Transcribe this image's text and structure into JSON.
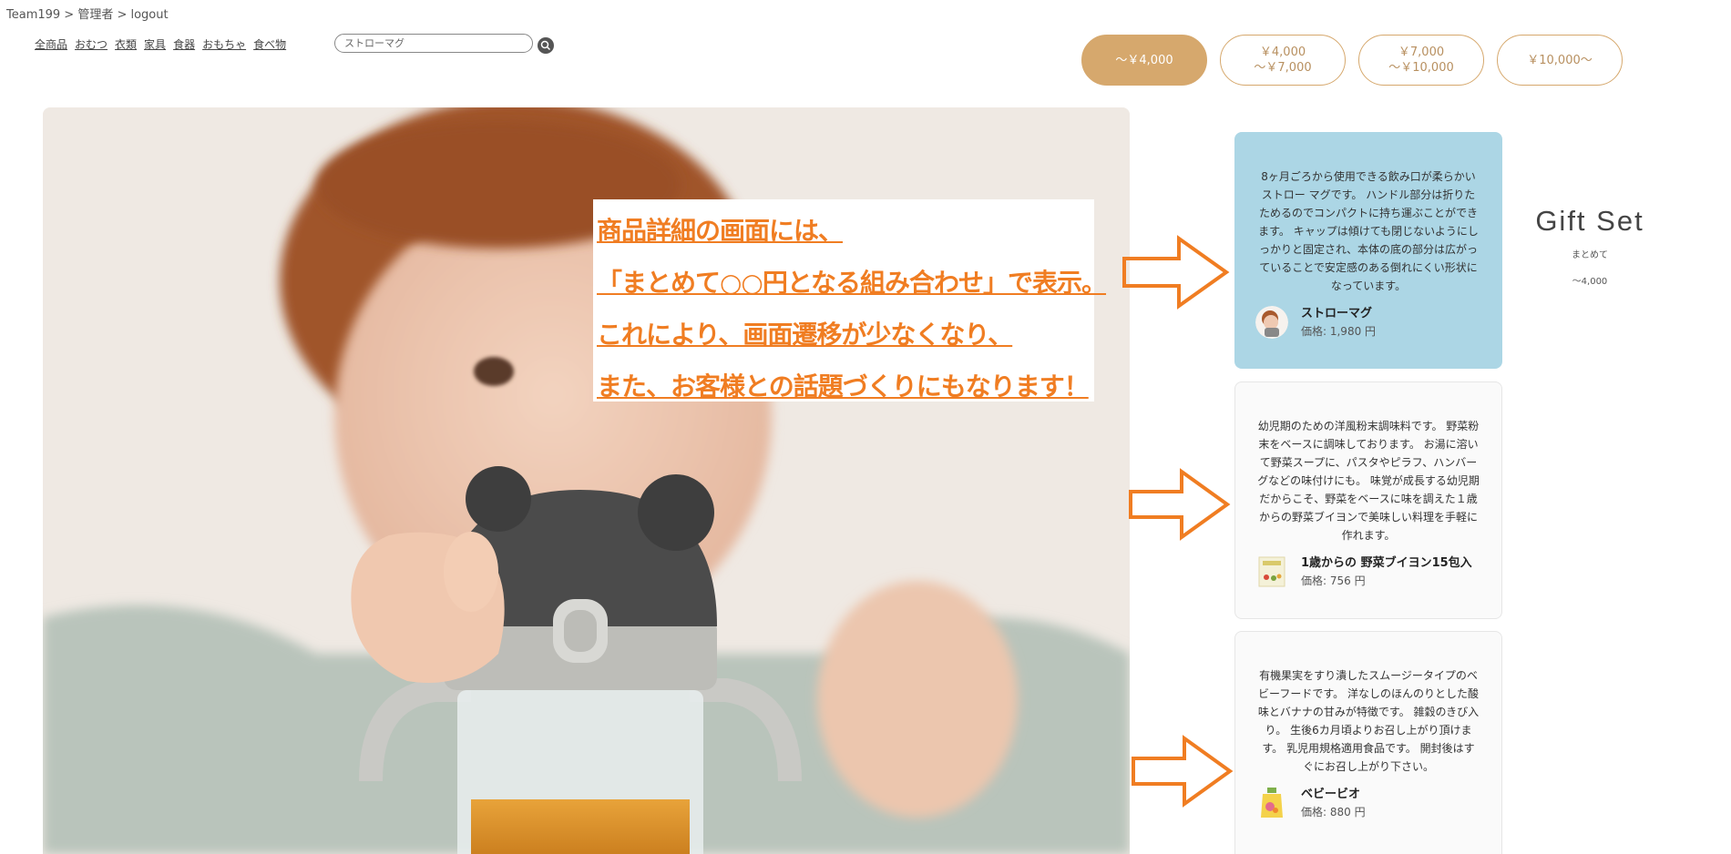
{
  "breadcrumb": "Team199 > 管理者 > logout",
  "nav": [
    "全商品",
    "おむつ",
    "衣類",
    "家具",
    "食器",
    "おもちゃ",
    "食べ物"
  ],
  "search": {
    "placeholder": "ストローマグ"
  },
  "price_filters": [
    {
      "label": "～￥4,000",
      "active": true
    },
    {
      "label": "￥4,000\n～￥7,000",
      "active": false
    },
    {
      "label": "￥7,000\n～￥10,000",
      "active": false
    },
    {
      "label": "￥10,000～",
      "active": false
    }
  ],
  "callout": [
    "商品詳細の画面には、",
    "「まとめて○○円となる組み合わせ」で表示。",
    "これにより、画面遷移が少なくなり、",
    "また、お客様との話題づくりにもなります！"
  ],
  "cards": [
    {
      "desc": "8ヶ月ごろから使用できる飲み口が柔らかいストロー マグです。 ハンドル部分は折りたためるのでコンパクトに持ち運ぶことができます。 キャップは傾けても閉じないようにしっかりと固定され、本体の底の部分は広がっていることで安定感のある倒れにくい形状になっています。",
      "name": "ストローマグ",
      "price": "価格: 1,980 円"
    },
    {
      "desc": "幼児期のための洋風粉末調味料です。 野菜粉末をベースに調味しております。 お湯に溶いて野菜スープに、パスタやピラフ、ハンバーグなどの味付けにも。 味覚が成長する幼児期だからこそ、野菜をベースに味を調えた１歳からの野菜ブイヨンで美味しい料理を手軽に作れます。",
      "name": "1歳からの 野菜ブイヨン15包入",
      "price": "価格: 756 円"
    },
    {
      "desc": "有機果実をすり潰したスムージータイプのベビーフードです。 洋なしのほんのりとした酸味とバナナの甘みが特徴です。 雑穀のきび入り。 生後6カ月頃よりお召し上がり頂けます。 乳児用規格適用食品です。 開封後はすぐにお召し上がり下さい。",
      "name": "ベビービオ",
      "price": "価格: 880 円"
    }
  ],
  "gift": {
    "title": "Gift Set",
    "subtitle": "まとめて",
    "price": "～4,000"
  },
  "colors": {
    "accent": "#d6a86d",
    "highlight": "#acd6e5",
    "callout": "#f07d22"
  }
}
